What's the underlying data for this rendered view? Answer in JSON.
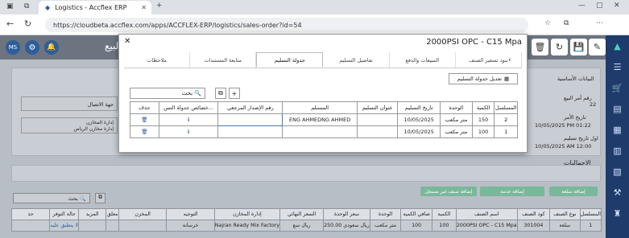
{
  "browser": {
    "tab_title": "Logistics - Accflex ERP",
    "url": "https://cloudbeta.accflex.com/apps/ACCFLEX-ERP/logistics/sales-order?id=54"
  },
  "header": {
    "user_initials": "MS",
    "page_title": "مر البيع"
  },
  "modal": {
    "title": "2000PSI OPC - C15 Mpa",
    "tabs": [
      "بنود تسعير الصنف",
      "المبيعات والدفع",
      "تفاصيل التسليم",
      "جدولة التسليم",
      "متابعة المستندات",
      "ملاحظات"
    ],
    "active_tab": "جدولة التسليم",
    "edit_button": "تعديل جدولة التسليم",
    "search_placeholder": "بحث",
    "columns": [
      "المسلسل",
      "الكمية",
      "الوحدة",
      "تاريخ التسليم",
      "عنوان التسليم",
      "المستلم",
      "رقم الإصدار المرجعي",
      "خصائص جدولة التس...",
      "حذف"
    ],
    "rows": [
      [
        "2",
        "150",
        "متر مكعب",
        "10/05/2025",
        "",
        "ENG AHMEDNG AHMED",
        "",
        "",
        ""
      ],
      [
        "1",
        "100",
        "متر مكعب",
        "10/05/2025",
        "",
        "",
        "",
        "",
        ""
      ]
    ]
  },
  "background": {
    "section_basic": "البيانات الأساسية",
    "order_number_label": "رقم أمر البيع",
    "order_number": "22",
    "order_date_label": "تاريخ الأمر",
    "order_date": "10/05/2025 PM 01:22",
    "first_delivery_label": "اول تاريخ تسليم",
    "first_delivery": "10/05/2025 AM 12:00",
    "contact_label": "جهة الاتصال",
    "store_label": "إدارة المخازن",
    "store_value": "إدارة مخازن الرياض",
    "totals": "الإجماليات",
    "buttons": [
      "إضافة سلعة",
      "إضافة خدمة",
      "إضافة صنف غير مسجل"
    ],
    "search": "بحث",
    "columns": [
      "المسلسل",
      "نوع الصنف",
      "كود الصنف",
      "اسم الصنف",
      "الكمية",
      "صافي الكمية",
      "الوحدة",
      "سعر الوحدة",
      "السعر النهائي",
      "إدارة المخازن",
      "التوجيه",
      "المخزن",
      "معلق",
      "المزيد",
      "حالة التوفر",
      "حذ"
    ],
    "row": [
      "1",
      "سلعة",
      "301004",
      "2000PSI OPC - C15 Mpa",
      "100",
      "100",
      "متر مكعب",
      "250.00 ريال سعودي",
      "ريال سع",
      "Najran Ready Mix Factory",
      "خرسانة",
      "",
      "",
      "",
      "لا ينطبق عليه",
      ""
    ]
  }
}
